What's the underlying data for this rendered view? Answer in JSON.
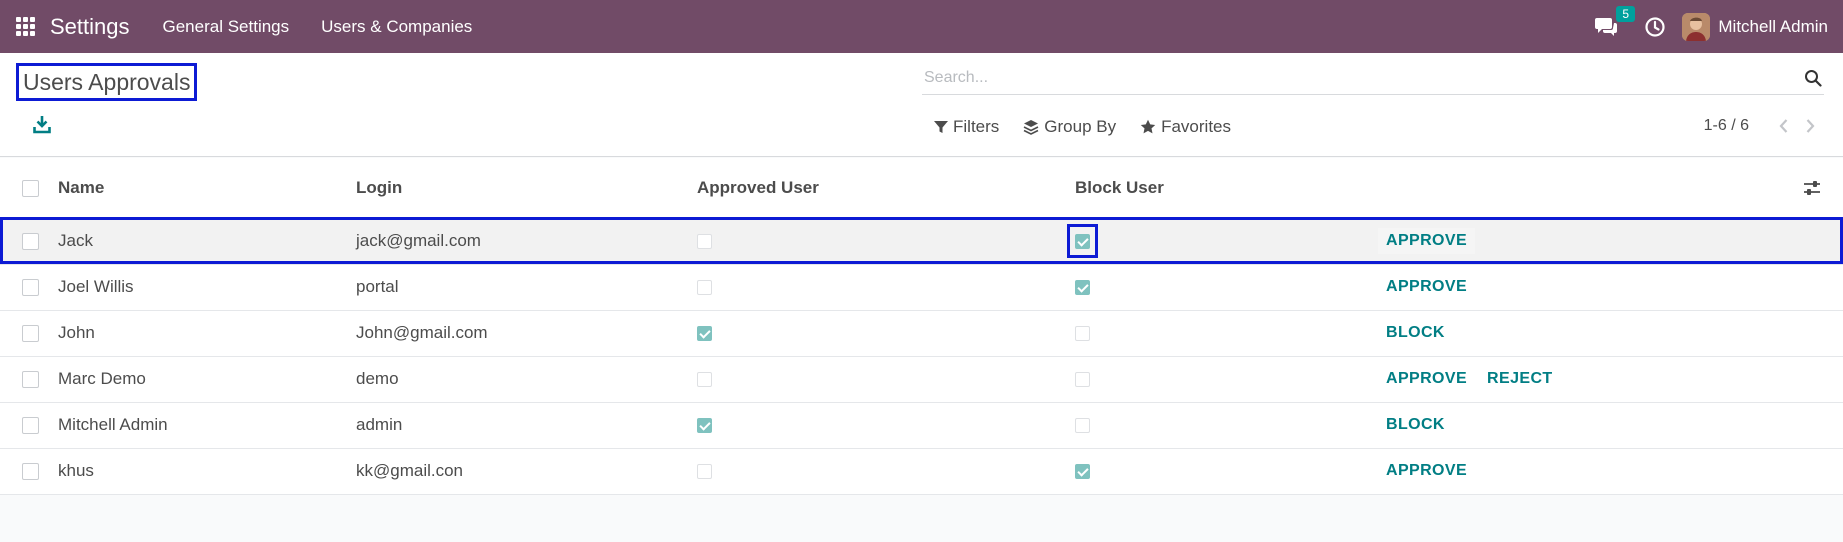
{
  "navbar": {
    "app_name": "Settings",
    "menus": [
      "General Settings",
      "Users & Companies"
    ],
    "chat_badge": "5",
    "user_name": "Mitchell Admin"
  },
  "control_panel": {
    "title": "Users Approvals",
    "search_placeholder": "Search...",
    "filters_label": "Filters",
    "group_by_label": "Group By",
    "favorites_label": "Favorites",
    "pager_value": "1-6 / 6"
  },
  "table": {
    "columns": [
      "Name",
      "Login",
      "Approved User",
      "Block User"
    ],
    "rows": [
      {
        "name": "Jack",
        "login": "jack@gmail.com",
        "approved": false,
        "blocked": true,
        "actions": [
          "APPROVE"
        ]
      },
      {
        "name": "Joel Willis",
        "login": "portal",
        "approved": false,
        "blocked": true,
        "actions": [
          "APPROVE"
        ]
      },
      {
        "name": "John",
        "login": "John@gmail.com",
        "approved": true,
        "blocked": false,
        "actions": [
          "BLOCK"
        ]
      },
      {
        "name": "Marc Demo",
        "login": "demo",
        "approved": false,
        "blocked": false,
        "actions": [
          "APPROVE",
          "REJECT"
        ]
      },
      {
        "name": "Mitchell Admin",
        "login": "admin",
        "approved": true,
        "blocked": false,
        "actions": [
          "BLOCK"
        ]
      },
      {
        "name": "khus",
        "login": "kk@gmail.con",
        "approved": false,
        "blocked": true,
        "actions": [
          "APPROVE"
        ]
      }
    ]
  },
  "colors": {
    "navbar": "#714b67",
    "accent": "#017e84",
    "checkbox_checked": "#7fc2bf",
    "highlight_border": "#0d1bd4"
  },
  "icons": {
    "apps": "apps-grid-icon",
    "chat": "chat-icon",
    "activity": "clock-icon",
    "download": "download-icon",
    "search": "search-icon",
    "filter": "filter-icon",
    "group_by": "layers-icon",
    "favorites": "star-icon",
    "optional_columns": "sliders-icon"
  }
}
